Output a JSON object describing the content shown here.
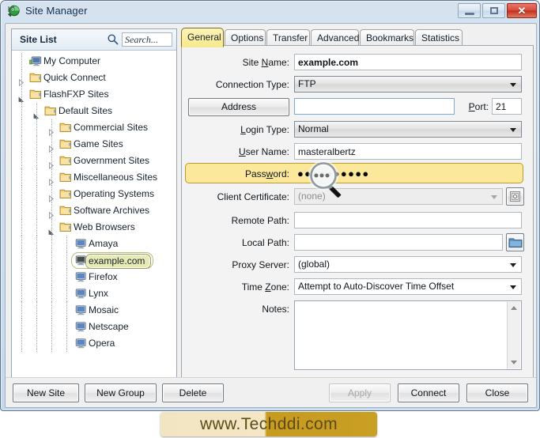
{
  "window": {
    "title": "Site Manager",
    "icon": "flashfxp-icon",
    "controls": {
      "minimize": "minimize-button",
      "maximize": "maximize-button",
      "close_glyph": "✕"
    }
  },
  "sidebar": {
    "title": "Site List",
    "search_icon": "search-icon",
    "search_placeholder": "Search...",
    "search_value": "",
    "tree": [
      {
        "label": "My Computer",
        "depth": 0,
        "icon": "computer-icon",
        "twist": "none",
        "selected": false
      },
      {
        "label": "Quick Connect",
        "depth": 0,
        "icon": "folder-icon",
        "twist": "collapsed",
        "selected": false
      },
      {
        "label": "FlashFXP Sites",
        "depth": 0,
        "icon": "folder-icon",
        "twist": "expanded",
        "selected": false
      },
      {
        "label": "Default Sites",
        "depth": 1,
        "icon": "folder-icon",
        "twist": "expanded",
        "selected": false
      },
      {
        "label": "Commercial Sites",
        "depth": 2,
        "icon": "folder-icon",
        "twist": "collapsed",
        "selected": false
      },
      {
        "label": "Game Sites",
        "depth": 2,
        "icon": "folder-icon",
        "twist": "collapsed",
        "selected": false
      },
      {
        "label": "Government Sites",
        "depth": 2,
        "icon": "folder-icon",
        "twist": "collapsed",
        "selected": false
      },
      {
        "label": "Miscellaneous Sites",
        "depth": 2,
        "icon": "folder-icon",
        "twist": "collapsed",
        "selected": false
      },
      {
        "label": "Operating Systems",
        "depth": 2,
        "icon": "folder-icon",
        "twist": "collapsed",
        "selected": false
      },
      {
        "label": "Software Archives",
        "depth": 2,
        "icon": "folder-icon",
        "twist": "collapsed",
        "selected": false
      },
      {
        "label": "Web Browsers",
        "depth": 2,
        "icon": "folder-icon",
        "twist": "expanded",
        "selected": false
      },
      {
        "label": "Amaya",
        "depth": 3,
        "icon": "site-icon",
        "twist": "none",
        "selected": false
      },
      {
        "label": "example.com",
        "depth": 3,
        "icon": "site-icon",
        "twist": "none",
        "selected": true
      },
      {
        "label": "Firefox",
        "depth": 3,
        "icon": "site-icon",
        "twist": "none",
        "selected": false
      },
      {
        "label": "Lynx",
        "depth": 3,
        "icon": "site-icon",
        "twist": "none",
        "selected": false
      },
      {
        "label": "Mosaic",
        "depth": 3,
        "icon": "site-icon",
        "twist": "none",
        "selected": false
      },
      {
        "label": "Netscape",
        "depth": 3,
        "icon": "site-icon",
        "twist": "none",
        "selected": false
      },
      {
        "label": "Opera",
        "depth": 3,
        "icon": "site-icon",
        "twist": "none",
        "selected": false
      }
    ]
  },
  "tabs": [
    {
      "label": "General",
      "active": true
    },
    {
      "label": "Options",
      "active": false
    },
    {
      "label": "Transfer",
      "active": false
    },
    {
      "label": "Advanced",
      "active": false
    },
    {
      "label": "Bookmarks",
      "active": false
    },
    {
      "label": "Statistics",
      "active": false
    }
  ],
  "form": {
    "site_name": {
      "label": "Site Name:",
      "value": "example.com"
    },
    "connection_type": {
      "label": "Connection Type:",
      "value": "FTP"
    },
    "address": {
      "button_label": "Address",
      "value": ""
    },
    "port": {
      "label": "Port:",
      "value": "21"
    },
    "login_type": {
      "label": "Login Type:",
      "value": "Normal"
    },
    "user_name": {
      "label": "User Name:",
      "value": "masteralbertz"
    },
    "password": {
      "label": "Password:",
      "value": "●●●●●●●●●●",
      "highlighted": true
    },
    "client_certificate": {
      "label": "Client Certificate:",
      "value": "(none)",
      "button_icon": "certificate-icon"
    },
    "remote_path": {
      "label": "Remote Path:",
      "value": ""
    },
    "local_path": {
      "label": "Local Path:",
      "value": "",
      "button_icon": "folder-browse-icon"
    },
    "proxy_server": {
      "label": "Proxy Server:",
      "value": "(global)"
    },
    "time_zone": {
      "label": "Time Zone:",
      "value": "Attempt to Auto-Discover Time Offset"
    },
    "notes": {
      "label": "Notes:",
      "value": ""
    }
  },
  "cursor": {
    "icon": "magnifier-cursor"
  },
  "buttons": {
    "new_site": "New Site",
    "new_group": "New Group",
    "delete": "Delete",
    "apply": "Apply",
    "connect": "Connect",
    "close": "Close"
  },
  "watermark": {
    "text": "www.Techddi.com"
  },
  "colors": {
    "accent_tab": "#f8e98e",
    "highlight_row": "#fbe89a",
    "selection": "#e8eab4",
    "close_button": "#c22f1d",
    "watermark_gold": "#c79b1e"
  }
}
